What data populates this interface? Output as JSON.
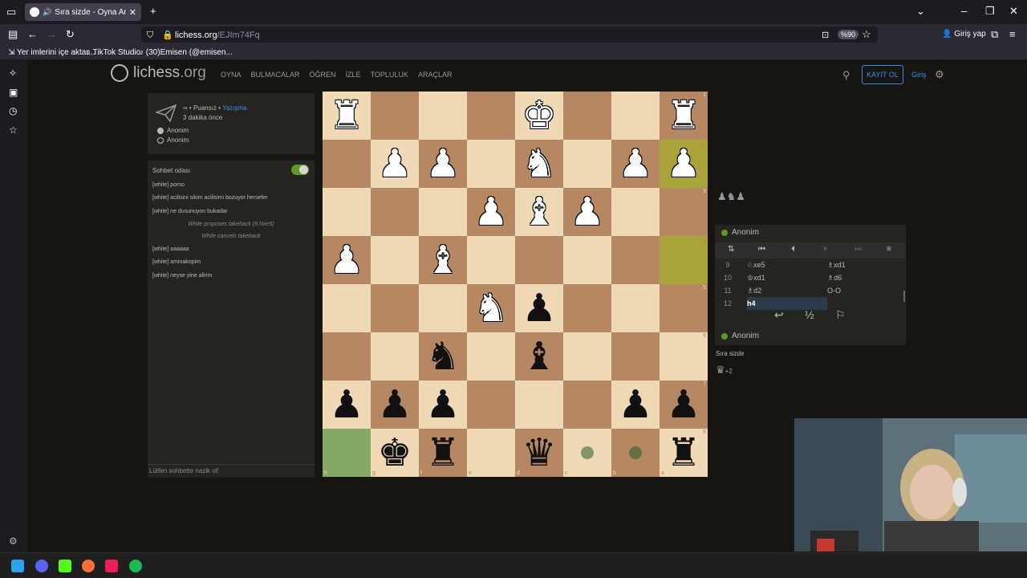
{
  "browser": {
    "tab_title": "Sıra sizde - Oyna Anon. • lic",
    "url_host": "lichess.org",
    "url_path": "/EJIm74Fq",
    "zoom": "%90",
    "signin": "Giriş yap",
    "bookmarks": [
      "Yer imlerini içe aktar...",
      "TikTok Studio",
      "(30)Emisen (@emisen..."
    ]
  },
  "site": {
    "logo": "lichess",
    "logo_tld": ".org",
    "nav": [
      "OYNA",
      "BULMACALAR",
      "ÖĞREN",
      "İZLE",
      "TOPLULUK",
      "ARAÇLAR"
    ],
    "signup": "KAYIT OL",
    "login": "Giriş"
  },
  "game": {
    "mode_prefix": "∞ • Puansız • ",
    "mode_link": "Yazışma",
    "time_ago": "3 dakika önce",
    "white": "Anonim",
    "black": "Anonim"
  },
  "chat": {
    "header": "Sohbet odası",
    "messages": [
      {
        "text": "[white] porno"
      },
      {
        "text": "[white] acilisini sikim acilisimi bozuyor hersefer"
      },
      {
        "text": "[white] ne dusunuyon bukadar"
      },
      {
        "text": "White proposes takeback (9.Nxe5)"
      },
      {
        "text": "White cancels takeback"
      },
      {
        "text": "[white] aaaaaa"
      },
      {
        "text": "[white] aminakopim"
      },
      {
        "text": "[white] neyse yine alirim"
      }
    ],
    "input_placeholder": "Lütfen sohbette nazik ol!"
  },
  "board": {
    "orientation": "black",
    "ranks": [
      [
        "wR",
        "",
        "",
        "",
        "wK",
        "",
        "",
        "wR"
      ],
      [
        "",
        "wP",
        "wP",
        "",
        "wN",
        "",
        "wP",
        "wP"
      ],
      [
        "",
        "",
        "",
        "wP",
        "wB",
        "wP",
        "",
        ""
      ],
      [
        "wP",
        "",
        "wB",
        "",
        "",
        "",
        "",
        ""
      ],
      [
        "",
        "",
        "",
        "wN",
        "bP",
        "",
        "",
        ""
      ],
      [
        "",
        "",
        "bN",
        "",
        "bB",
        "",
        "",
        ""
      ],
      [
        "bP",
        "bP",
        "bP",
        "",
        "",
        "",
        "bP",
        "bP"
      ],
      [
        "",
        "bK",
        "bR",
        "",
        "bQ",
        "dot",
        "dot",
        "bR"
      ]
    ],
    "highlight_last_move": [
      "a2",
      "a4"
    ],
    "selected": "h8",
    "rank_labels": [
      "1",
      "2",
      "3",
      "4",
      "5",
      "6",
      "7",
      "8"
    ],
    "file_labels": [
      "h",
      "g",
      "f",
      "e",
      "d",
      "c",
      "b",
      "a"
    ]
  },
  "panel": {
    "captured_top": "♟♞♟",
    "opponent": "Anonim",
    "player": "Anonim",
    "moves": [
      {
        "n": "9",
        "w": "♘xe5",
        "b": "♗xd1"
      },
      {
        "n": "10",
        "w": "♔xd1",
        "b": "♗d6"
      },
      {
        "n": "11",
        "w": "♗d2",
        "b": "O-O"
      },
      {
        "n": "12",
        "w": "h4",
        "b": ""
      }
    ],
    "status": "Sıra sizde",
    "captured_bottom": "♛",
    "material_diff": "+2"
  },
  "colors": {
    "board_light": "#f0d9b5",
    "board_dark": "#b58863",
    "accent": "#3692e7",
    "online": "#629924"
  }
}
